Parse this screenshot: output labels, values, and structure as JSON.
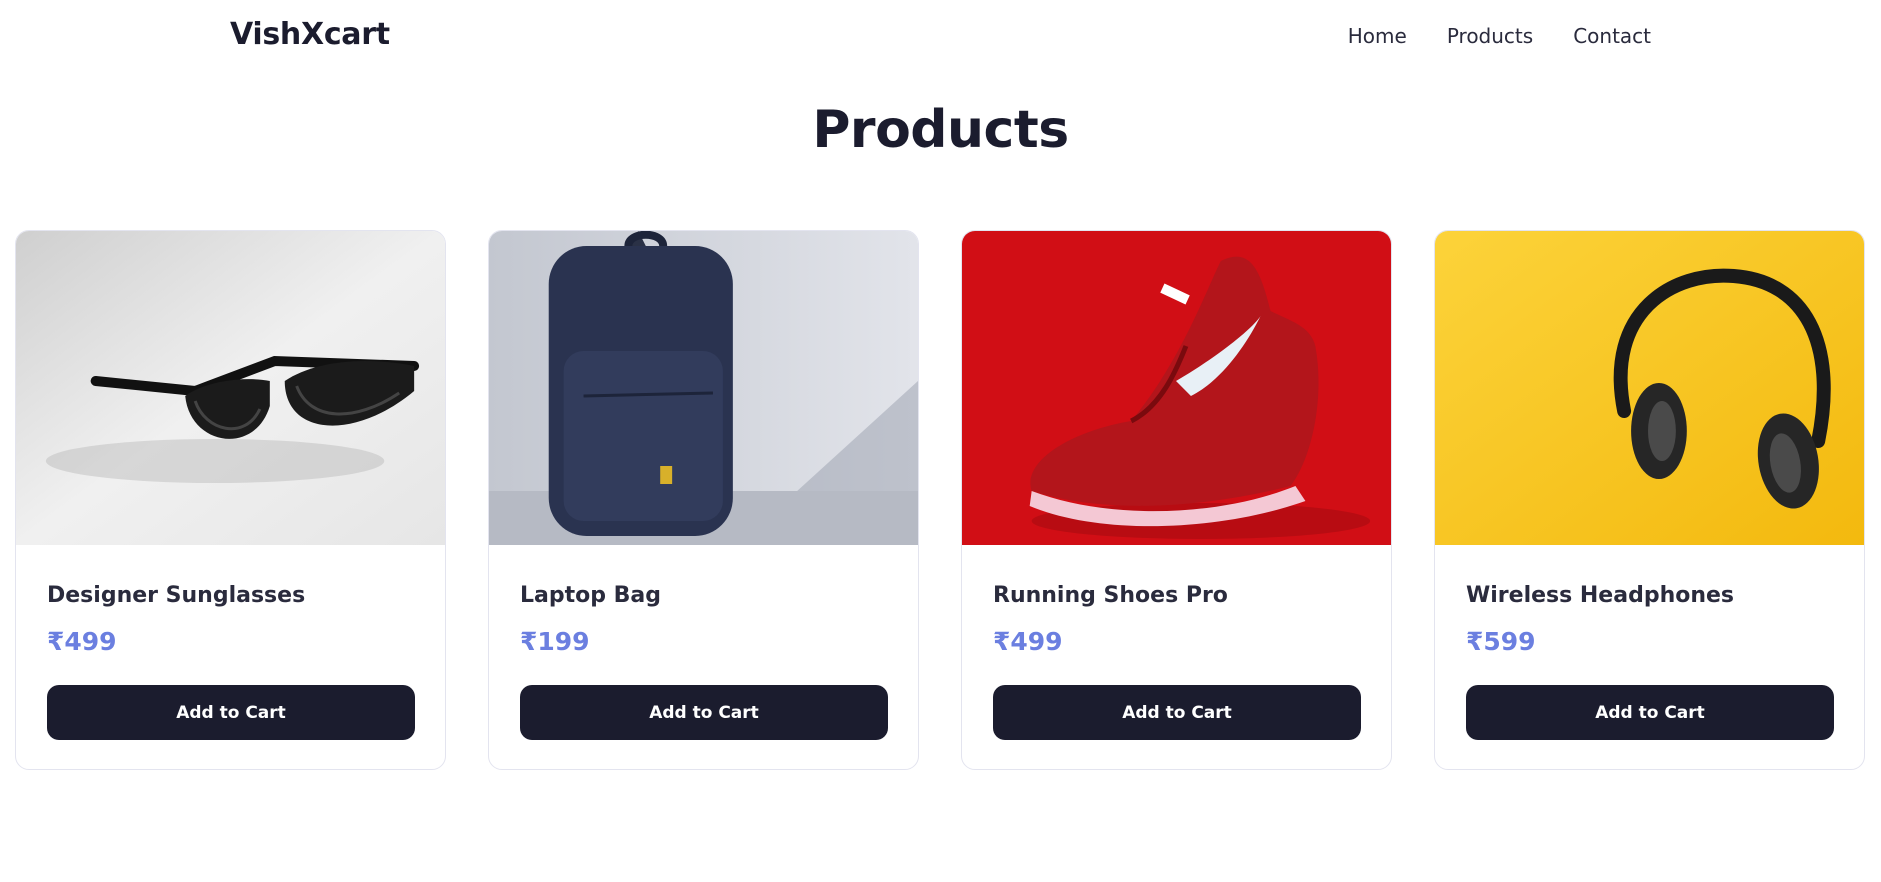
{
  "header": {
    "brand": "VishXcart",
    "nav": [
      "Home",
      "Products",
      "Contact"
    ]
  },
  "main": {
    "title": "Products",
    "products": [
      {
        "name": "Designer Sunglasses",
        "price": "₹499",
        "button": "Add to Cart",
        "image": "sunglasses-photo"
      },
      {
        "name": "Laptop Bag",
        "price": "₹199",
        "button": "Add to Cart",
        "image": "backpack-photo"
      },
      {
        "name": "Running Shoes Pro",
        "price": "₹499",
        "button": "Add to Cart",
        "image": "red-sneaker-photo"
      },
      {
        "name": "Wireless Headphones",
        "price": "₹599",
        "button": "Add to Cart",
        "image": "headphones-photo"
      }
    ]
  },
  "colors": {
    "dark": "#1b1c2e",
    "price": "#6b7fe0",
    "border": "#e3e4ef"
  }
}
